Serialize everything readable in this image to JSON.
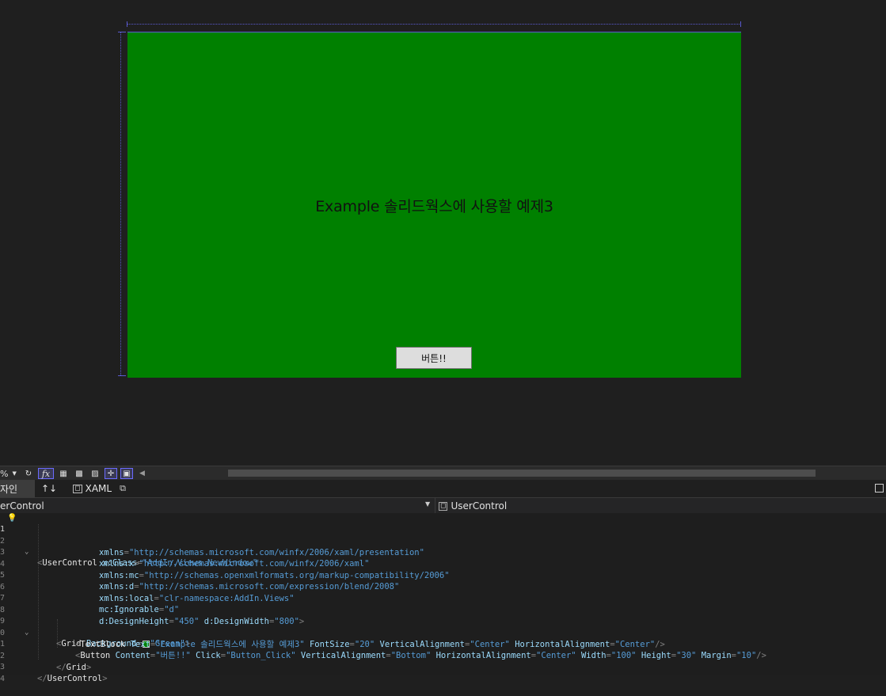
{
  "designer": {
    "textblock_text": "Example 솔리드웍스에 사용할 예제3",
    "button_content": "버튼!!",
    "background_color": "#008000"
  },
  "toolbar": {
    "zoom_suffix": "%",
    "icons": [
      "refresh-icon",
      "fx-icon",
      "grid-icon",
      "snap-grid-icon",
      "checker-icon",
      "snap-lines-icon",
      "device-icon"
    ]
  },
  "tabs": {
    "design_label": "자인",
    "swap_label": "↑↓",
    "xaml_label": "XAML"
  },
  "nav": {
    "left_text": "erControl",
    "right_text": "UserControl"
  },
  "code": {
    "line_numbers": [
      "1",
      "2",
      "3",
      "4",
      "5",
      "6",
      "7",
      "8",
      "9",
      "0",
      "1",
      "2",
      "3",
      "4"
    ],
    "l1": {
      "tag": "UserControl",
      "attr": "x:Class",
      "val": "\"AddIn.Views.NewWindow\""
    },
    "l2": {
      "attr": "xmlns",
      "val": "\"http://schemas.microsoft.com/winfx/2006/xaml/presentation\""
    },
    "l3": {
      "attr": "xmlns:x",
      "val": "\"http://schemas.microsoft.com/winfx/2006/xaml\""
    },
    "l4": {
      "attr": "xmlns:mc",
      "val": "\"http://schemas.openxmlformats.org/markup-compatibility/2006\""
    },
    "l5": {
      "attr": "xmlns:d",
      "val": "\"http://schemas.microsoft.com/expression/blend/2008\""
    },
    "l6": {
      "attr": "xmlns:local",
      "val": "\"clr-namespace:AddIn.Views\""
    },
    "l7": {
      "attr": "mc:Ignorable",
      "val": "\"d\""
    },
    "l8": {
      "attr1": "d:DesignHeight",
      "val1": "\"450\"",
      "attr2": "d:DesignWidth",
      "val2": "\"800\""
    },
    "l9": {
      "tag": "Grid",
      "attr": "Background",
      "val": "\"Green\""
    },
    "l10": {
      "tag": "TextBlock",
      "a1": "Text",
      "v1": "\"Example 솔리드웍스에 사용할 예제3\"",
      "a2": "FontSize",
      "v2": "\"20\"",
      "a3": "VerticalAlignment",
      "v3": "\"Center\"",
      "a4": "HorizontalAlignment",
      "v4": "\"Center\""
    },
    "l11": {
      "tag": "Button",
      "a1": "Content",
      "v1": "\"버튼!!\"",
      "a2": "Click",
      "v2": "\"Button_Click\"",
      "a3": "VerticalAlignment",
      "v3": "\"Bottom\"",
      "a4": "HorizontalAlignment",
      "v4": "\"Center\"",
      "a5": "Width",
      "v5": "\"100\"",
      "a6": "Height",
      "v6": "\"30\"",
      "a7": "Margin",
      "v7": "\"10\""
    },
    "l12": {
      "tag": "Grid"
    },
    "l13": {
      "tag": "UserControl"
    }
  }
}
